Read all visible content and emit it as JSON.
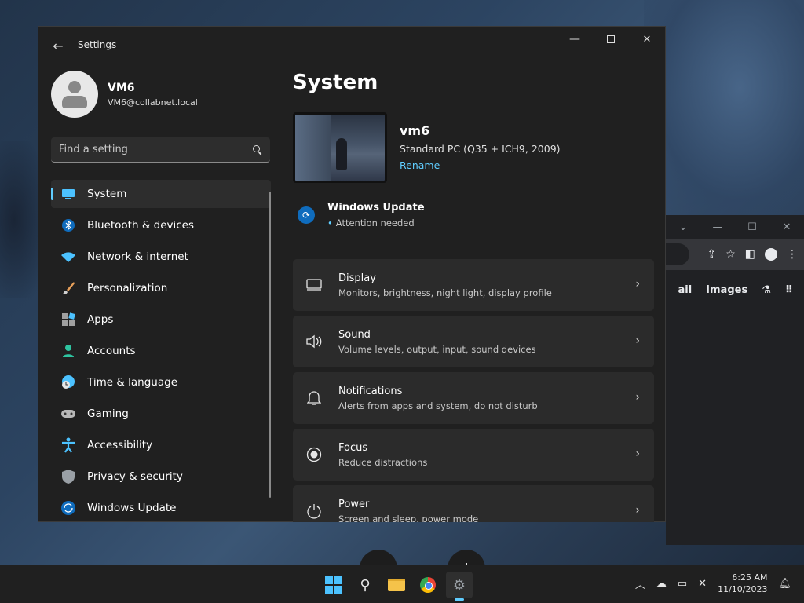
{
  "window": {
    "title": "Settings",
    "back_glyph": "←",
    "min_glyph": "—",
    "close_glyph": "✕"
  },
  "user": {
    "name": "VM6",
    "email": "VM6@collabnet.local"
  },
  "search": {
    "placeholder": "Find a setting"
  },
  "nav": {
    "items": [
      {
        "label": "System",
        "icon": "monitor-icon",
        "selected": true
      },
      {
        "label": "Bluetooth & devices",
        "icon": "bluetooth-icon"
      },
      {
        "label": "Network & internet",
        "icon": "wifi-icon"
      },
      {
        "label": "Personalization",
        "icon": "brush-icon"
      },
      {
        "label": "Apps",
        "icon": "apps-icon"
      },
      {
        "label": "Accounts",
        "icon": "person-icon"
      },
      {
        "label": "Time & language",
        "icon": "globe-clock-icon"
      },
      {
        "label": "Gaming",
        "icon": "gamepad-icon"
      },
      {
        "label": "Accessibility",
        "icon": "accessibility-icon"
      },
      {
        "label": "Privacy & security",
        "icon": "shield-icon"
      },
      {
        "label": "Windows Update",
        "icon": "update-icon"
      }
    ]
  },
  "main": {
    "title": "System",
    "device": {
      "name": "vm6",
      "model": "Standard PC (Q35 + ICH9, 2009)",
      "rename_label": "Rename"
    },
    "update": {
      "title": "Windows Update",
      "status": "Attention needed"
    },
    "cards": [
      {
        "title": "Display",
        "subtitle": "Monitors, brightness, night light, display profile",
        "icon": "display-icon"
      },
      {
        "title": "Sound",
        "subtitle": "Volume levels, output, input, sound devices",
        "icon": "speaker-icon"
      },
      {
        "title": "Notifications",
        "subtitle": "Alerts from apps and system, do not disturb",
        "icon": "bell-icon"
      },
      {
        "title": "Focus",
        "subtitle": "Reduce distractions",
        "icon": "focus-icon"
      },
      {
        "title": "Power",
        "subtitle": "Screen and sleep, power mode",
        "icon": "power-icon"
      }
    ]
  },
  "browser_bg": {
    "links": [
      "ail",
      "Images"
    ]
  },
  "taskbar": {
    "time": "6:25 AM",
    "date": "11/10/2023"
  },
  "colors": {
    "accent": "#60cdff",
    "window_bg": "#202020",
    "card_bg": "#2b2b2b"
  }
}
